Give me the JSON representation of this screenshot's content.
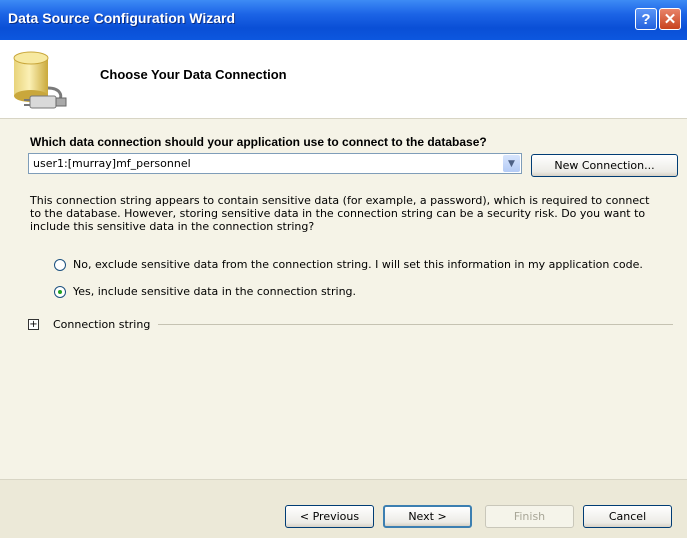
{
  "window": {
    "title": "Data Source Configuration Wizard"
  },
  "titlebar": {
    "help_label": "?",
    "close_label": "✕"
  },
  "header": {
    "title": "Choose Your Data Connection",
    "icon": "database-icon"
  },
  "connection": {
    "question": "Which data connection should your application use to connect to the database?",
    "selected": "user1:[murray]mf_personnel",
    "new_button": "New Connection..."
  },
  "sensitive": {
    "description": "This connection string appears to contain sensitive data (for example, a password), which is required to connect to the database. However, storing sensitive data in the connection string can be a security risk. Do you want to include this sensitive data in the connection string?",
    "option_no": "No, exclude sensitive data from the connection string. I will set this information in my application code.",
    "option_yes": "Yes, include sensitive data in the connection string.",
    "selected_option": "yes"
  },
  "expander": {
    "label": "Connection string",
    "expanded": false
  },
  "footer": {
    "previous": "< Previous",
    "next": "Next >",
    "finish": "Finish",
    "cancel": "Cancel"
  },
  "colors": {
    "titlebar": "#0a4fd6",
    "dialog": "#ece9d8",
    "content": "#f5f3e7"
  }
}
